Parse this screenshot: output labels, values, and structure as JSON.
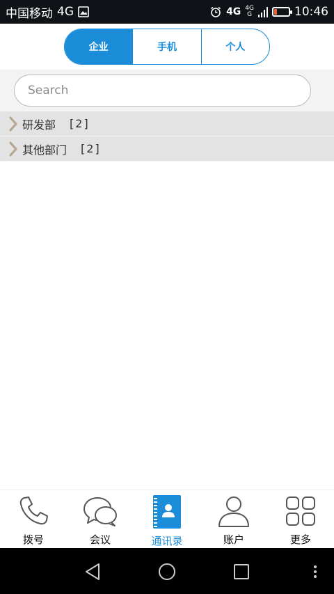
{
  "status_bar": {
    "carrier": "中国移动",
    "network": "4G",
    "network_right": "4G",
    "network_small_top": "4G",
    "network_small_bottom": "G",
    "time": "10:46",
    "battery_level": 0.18,
    "battery_color": "#e8642c"
  },
  "tabs": [
    {
      "label": "企业",
      "active": true
    },
    {
      "label": "手机",
      "active": false
    },
    {
      "label": "个人",
      "active": false
    }
  ],
  "search": {
    "placeholder": "Search",
    "value": ""
  },
  "groups": [
    {
      "name": "研发部",
      "count": "[2]"
    },
    {
      "name": "其他部门",
      "count": "[2]"
    }
  ],
  "bottom_nav": [
    {
      "label": "拨号",
      "icon": "phone-icon",
      "active": false
    },
    {
      "label": "会议",
      "icon": "chat-bubbles-icon",
      "active": false
    },
    {
      "label": "通讯录",
      "icon": "contacts-book-icon",
      "active": true
    },
    {
      "label": "账户",
      "icon": "user-icon",
      "active": false
    },
    {
      "label": "更多",
      "icon": "grid-icon",
      "active": false
    }
  ],
  "colors": {
    "accent": "#1a8cd8",
    "group_bg": "#e3e3e3",
    "chevron": "#b8a48c"
  }
}
